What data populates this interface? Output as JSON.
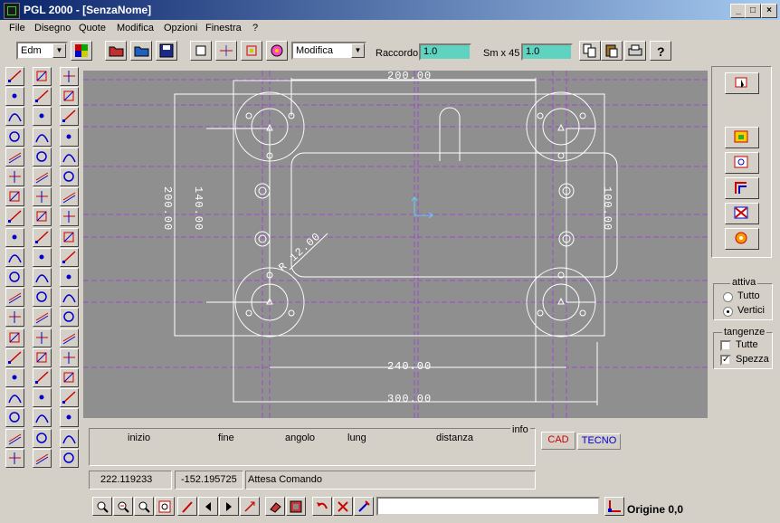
{
  "window": {
    "title": "PGL 2000  - [SenzaNome]"
  },
  "menu": [
    "File",
    "Disegno",
    "Quote",
    "Modifica",
    "Opzioni",
    "Finestra",
    "?"
  ],
  "toolbar": {
    "layer_value": "Edm",
    "mode_value": "Modifica",
    "raccordo_label": "Raccordo",
    "raccordo_value": "1.0",
    "sm45_label": "Sm x 45",
    "sm45_value": "1.0"
  },
  "drawing": {
    "dim_top": "200.00",
    "dim_mid": "240.00",
    "dim_bottom": "300.00",
    "dim_radius": "R 12.00",
    "dim_left_outer": "200.00",
    "dim_left_inner": "140.00",
    "dim_right": "100.00"
  },
  "info_panel": {
    "title": "info",
    "columns": [
      "inizio",
      "fine",
      "angolo",
      "lung",
      "distanza"
    ]
  },
  "tabs": {
    "cad": "CAD",
    "tecno": "TECNO"
  },
  "status": {
    "x": "222.119233",
    "y": "-152.195725",
    "message": "Attesa Comando",
    "origin": "Origine 0,0"
  },
  "right_panel": {
    "attiva_title": "attiva",
    "attiva_options": [
      "Tutto",
      "Vertici"
    ],
    "attiva_selected": "Vertici",
    "tangenze_title": "tangenze",
    "tangenze_options": [
      {
        "label": "Tutte",
        "checked": false
      },
      {
        "label": "Spezza",
        "checked": true
      }
    ]
  },
  "colors": {
    "canvas": "#8f8f8f",
    "drawing_lines": "#ffffff",
    "construction_lines": "#9b4dc8",
    "input_teal": "#5fd3c0",
    "tab_cad": "#cc0000",
    "tab_tecno": "#0000cc"
  }
}
